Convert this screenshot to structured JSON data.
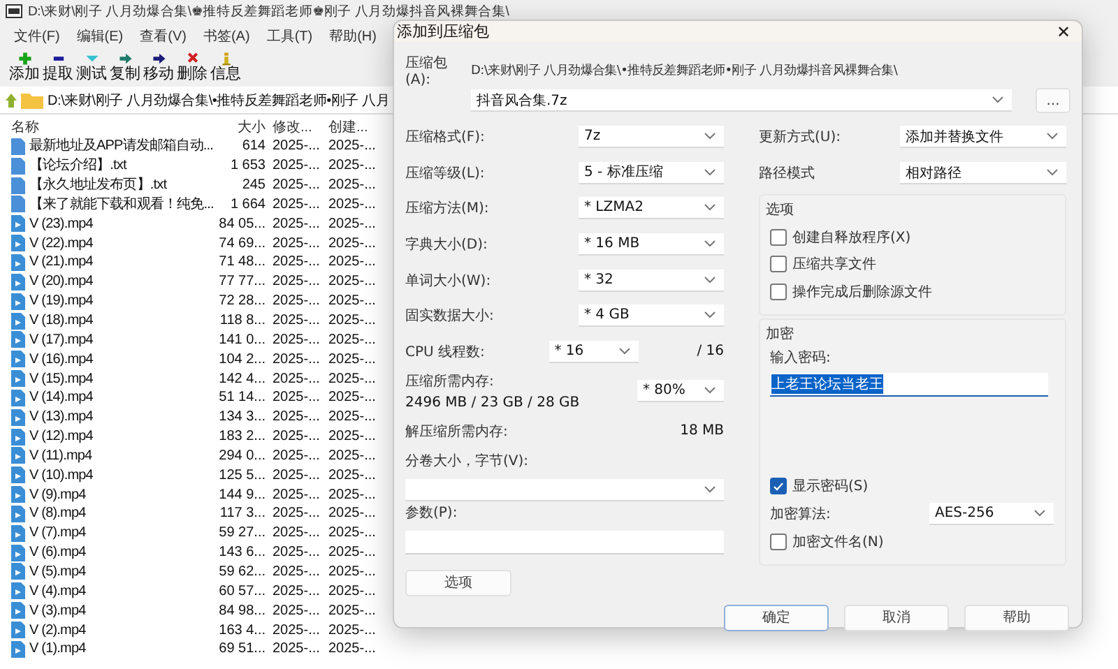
{
  "main_window": {
    "title": "D:\\来财\\刚子 八月劲爆合集\\♚推特反差舞蹈老师♚刚子 八月劲爆抖音风裸舞合集\\",
    "menu": [
      "文件(F)",
      "编辑(E)",
      "查看(V)",
      "书签(A)",
      "工具(T)",
      "帮助(H)"
    ],
    "toolbar": [
      {
        "label": "添加",
        "kind": "add"
      },
      {
        "label": "提取",
        "kind": "extract"
      },
      {
        "label": "测试",
        "kind": "test"
      },
      {
        "label": "复制",
        "kind": "copy"
      },
      {
        "label": "移动",
        "kind": "move"
      },
      {
        "label": "删除",
        "kind": "delete"
      },
      {
        "label": "信息",
        "kind": "info"
      }
    ],
    "address": "D:\\来财\\刚子 八月劲爆合集\\•推特反差舞蹈老师•刚子 八月",
    "columns": [
      "名称",
      "大小",
      "修改...",
      "创建..."
    ],
    "rows": [
      {
        "name": "最新地址及APP请发邮箱自动...",
        "kind": "text",
        "size": "614",
        "modified": "2025-...",
        "created": "2025-..."
      },
      {
        "name": "【论坛介绍】.txt",
        "kind": "text",
        "size": "1 653",
        "modified": "2025-...",
        "created": "2025-..."
      },
      {
        "name": "【永久地址发布页】.txt",
        "kind": "text",
        "size": "245",
        "modified": "2025-...",
        "created": "2025-..."
      },
      {
        "name": "【来了就能下载和观看！纯免...",
        "kind": "text",
        "size": "1 664",
        "modified": "2025-...",
        "created": "2025-..."
      },
      {
        "name": "V (23).mp4",
        "kind": "video",
        "size": "84 05...",
        "modified": "2025-...",
        "created": "2025-..."
      },
      {
        "name": "V (22).mp4",
        "kind": "video",
        "size": "74 69...",
        "modified": "2025-...",
        "created": "2025-..."
      },
      {
        "name": "V (21).mp4",
        "kind": "video",
        "size": "71 48...",
        "modified": "2025-...",
        "created": "2025-..."
      },
      {
        "name": "V (20).mp4",
        "kind": "video",
        "size": "77 77...",
        "modified": "2025-...",
        "created": "2025-..."
      },
      {
        "name": "V (19).mp4",
        "kind": "video",
        "size": "72 28...",
        "modified": "2025-...",
        "created": "2025-..."
      },
      {
        "name": "V (18).mp4",
        "kind": "video",
        "size": "118 8...",
        "modified": "2025-...",
        "created": "2025-..."
      },
      {
        "name": "V (17).mp4",
        "kind": "video",
        "size": "141 0...",
        "modified": "2025-...",
        "created": "2025-..."
      },
      {
        "name": "V (16).mp4",
        "kind": "video",
        "size": "104 2...",
        "modified": "2025-...",
        "created": "2025-..."
      },
      {
        "name": "V (15).mp4",
        "kind": "video",
        "size": "142 4...",
        "modified": "2025-...",
        "created": "2025-..."
      },
      {
        "name": "V (14).mp4",
        "kind": "video",
        "size": "51 14...",
        "modified": "2025-...",
        "created": "2025-..."
      },
      {
        "name": "V (13).mp4",
        "kind": "video",
        "size": "134 3...",
        "modified": "2025-...",
        "created": "2025-..."
      },
      {
        "name": "V (12).mp4",
        "kind": "video",
        "size": "183 2...",
        "modified": "2025-...",
        "created": "2025-..."
      },
      {
        "name": "V (11).mp4",
        "kind": "video",
        "size": "294 0...",
        "modified": "2025-...",
        "created": "2025-..."
      },
      {
        "name": "V (10).mp4",
        "kind": "video",
        "size": "125 5...",
        "modified": "2025-...",
        "created": "2025-..."
      },
      {
        "name": "V (9).mp4",
        "kind": "video",
        "size": "144 9...",
        "modified": "2025-...",
        "created": "2025-..."
      },
      {
        "name": "V (8).mp4",
        "kind": "video",
        "size": "117 3...",
        "modified": "2025-...",
        "created": "2025-..."
      },
      {
        "name": "V (7).mp4",
        "kind": "video",
        "size": "59 27...",
        "modified": "2025-...",
        "created": "2025-..."
      },
      {
        "name": "V (6).mp4",
        "kind": "video",
        "size": "143 6...",
        "modified": "2025-...",
        "created": "2025-..."
      },
      {
        "name": "V (5).mp4",
        "kind": "video",
        "size": "59 62...",
        "modified": "2025-...",
        "created": "2025-..."
      },
      {
        "name": "V (4).mp4",
        "kind": "video",
        "size": "60 57...",
        "modified": "2025-...",
        "created": "2025-..."
      },
      {
        "name": "V (3).mp4",
        "kind": "video",
        "size": "84 98...",
        "modified": "2025-...",
        "created": "2025-..."
      },
      {
        "name": "V (2).mp4",
        "kind": "video",
        "size": "163 4...",
        "modified": "2025-...",
        "created": "2025-..."
      },
      {
        "name": "V (1).mp4",
        "kind": "video",
        "size": "69 51...",
        "modified": "2025-...",
        "created": "2025-..."
      }
    ]
  },
  "dialog": {
    "title": "添加到压缩包",
    "close": "✕",
    "archive": {
      "label": "压缩包(A):",
      "path": "D:\\来财\\刚子 八月劲爆合集\\•推特反差舞蹈老师•刚子 八月劲爆抖音风裸舞合集\\",
      "value": "抖音风合集.7z",
      "browse": "..."
    },
    "settings": [
      {
        "kind": "select",
        "label": "压缩格式(F):",
        "value": "7z"
      },
      {
        "kind": "select",
        "label": "压缩等级(L):",
        "value": "5 - 标准压缩"
      },
      {
        "kind": "select",
        "label": "压缩方法(M):",
        "value": "*  LZMA2"
      },
      {
        "kind": "select",
        "label": "字典大小(D):",
        "value": "*  16 MB"
      },
      {
        "kind": "select",
        "label": "单词大小(W):",
        "value": "*  32"
      },
      {
        "kind": "select",
        "label": "固实数据大小:",
        "value": "*  4 GB"
      },
      {
        "kind": "cpu",
        "label": "CPU 线程数:",
        "value": "*  16",
        "suffix": "/ 16"
      },
      {
        "kind": "memory",
        "label": "压缩所需内存:",
        "info": "2496 MB / 23 GB / 28 GB",
        "value": "* 80%"
      },
      {
        "kind": "reading",
        "label": "解压缩所需内存:",
        "reading": "18 MB"
      },
      {
        "kind": "volume",
        "label": "分卷大小，字节(V):"
      },
      {
        "kind": "params",
        "label": "参数(P):"
      }
    ],
    "options_button": "选项",
    "update_mode": {
      "label": "更新方式(U):",
      "value": "添加并替换文件"
    },
    "path_mode": {
      "label": "路径模式",
      "value": "相对路径"
    },
    "options": {
      "title": "选项",
      "checkboxes": [
        {
          "label": "创建自释放程序(X)",
          "checked": false
        },
        {
          "label": "压缩共享文件",
          "checked": false
        },
        {
          "label": "操作完成后删除源文件",
          "checked": false
        }
      ]
    },
    "encryption": {
      "title": "加密",
      "password_label": "输入密码:",
      "password": {
        "value": "上老王论坛当老王",
        "selected": true
      },
      "show_password": {
        "label": "显示密码(S)",
        "checked": true
      },
      "algorithm": {
        "label": "加密算法:",
        "value": "AES-256"
      },
      "encrypt_names": {
        "label": "加密文件名(N)",
        "checked": false
      }
    },
    "buttons": [
      {
        "label": "确定",
        "default": true
      },
      {
        "label": "取消",
        "default": false
      },
      {
        "label": "帮助",
        "default": false
      }
    ]
  }
}
